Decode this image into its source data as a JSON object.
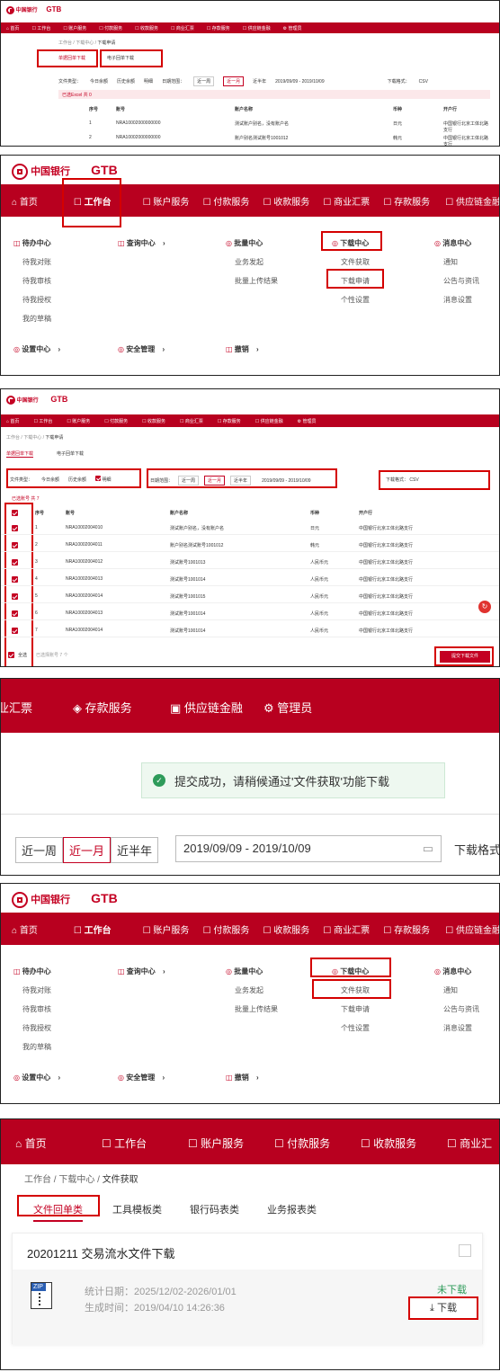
{
  "bank": {
    "name_cn": "中国银行",
    "name_en": "BANK OF CHINA",
    "product": "GTB"
  },
  "nav": {
    "home": "首页",
    "workbench": "工作台",
    "account": "账户服务",
    "payment": "付款服务",
    "collection": "收款服务",
    "bill": "商业汇票",
    "deposit": "存款服务",
    "supply": "供应链金融",
    "admin": "管理员",
    "p1_collection": "收款服务",
    "p1_bill": "商业汇票",
    "p6_bill": "商业汇"
  },
  "p1": {
    "breadcrumb": [
      "工作台",
      "下载中心",
      "下载申请"
    ],
    "tabs": [
      "单据回单下载",
      "电子回单下载"
    ],
    "filters": {
      "label": "文件类型：",
      "today": "今日余额",
      "history": "历史余额",
      "detail": "明细",
      "range_label": "日期范围：",
      "week": "近一周",
      "month": "近一月",
      "half": "近半年",
      "date": "2019/09/09 - 2019/10/09",
      "fmt_label": "下载格式：",
      "fmt": "CSV"
    },
    "selected": "已选Excel  共 0",
    "headers": [
      "序号",
      "账号",
      "账户名称",
      "币种",
      "开户行"
    ],
    "rows": [
      {
        "no": "1",
        "acct": "NRA10002000000000",
        "name": "测试账户别名，没有账户名",
        "cur": "日元",
        "bank": "中国银行北京工体北路支行"
      },
      {
        "no": "2",
        "acct": "NRA10002000000000",
        "name": "账户别名测试账号1001012",
        "cur": "韩元",
        "bank": "中国银行北京工体北路支行"
      }
    ]
  },
  "menu": {
    "pending": "待办中心",
    "pending_items": [
      "待我对账",
      "待我审核",
      "待我授权",
      "我的草稿"
    ],
    "query": "查询中心",
    "batch": "批量中心",
    "batch_items": [
      "业务发起",
      "批量上传结果"
    ],
    "download": "下载中心",
    "download_items": [
      "文件获取",
      "下载申请",
      "个性设置"
    ],
    "message": "消息中心",
    "message_items": [
      "通知",
      "公告与资讯",
      "消息设置"
    ],
    "settings": "设置中心",
    "security": "安全管理",
    "revoke": "撤销",
    "arrow": "›"
  },
  "p3": {
    "breadcrumb": [
      "工作台",
      "下载中心",
      "下载申请"
    ],
    "tabs": [
      "单据回单下载",
      "电子回单下载"
    ],
    "filters": {
      "label": "文件类型：",
      "today": "今日余额",
      "history": "历史余额",
      "detail": "明细",
      "range_label": "日期范围：",
      "week": "近一周",
      "month": "近一月",
      "half": "近半年",
      "date": "2019/09/09 - 2019/10/09",
      "fmt_label": "下载格式：",
      "fmt": "CSV"
    },
    "selected": "已选账号  共 7",
    "headers": [
      "序号",
      "账号",
      "账户名称",
      "币种",
      "开户行"
    ],
    "rows": [
      {
        "no": "1",
        "acct": "NRA10002004010",
        "name": "测试账户别名，没有账户名",
        "cur": "日元",
        "bank": "中国银行北京工体北路支行"
      },
      {
        "no": "2",
        "acct": "NRA10002004011",
        "name": "账户别名测试账号1001012",
        "cur": "韩元",
        "bank": "中国银行北京工体北路支行"
      },
      {
        "no": "3",
        "acct": "NRA10002004012",
        "name": "测试账号1001013",
        "cur": "人民币元",
        "bank": "中国银行北京工体北路支行"
      },
      {
        "no": "4",
        "acct": "NRA10002004013",
        "name": "测试账号1001014",
        "cur": "人民币元",
        "bank": "中国银行北京工体北路支行"
      },
      {
        "no": "5",
        "acct": "NRA10002004014",
        "name": "测试账号1001015",
        "cur": "人民币元",
        "bank": "中国银行北京工体北路支行"
      },
      {
        "no": "6",
        "acct": "NRA10002004013",
        "name": "测试账号1001014",
        "cur": "人民币元",
        "bank": "中国银行北京工体北路支行"
      },
      {
        "no": "7",
        "acct": "NRA10002004014",
        "name": "测试账号1001014",
        "cur": "人民币元",
        "bank": "中国银行北京工体北路支行"
      }
    ],
    "select_all": "全选",
    "footer_note": "已选择账号 7 个",
    "submit": "提交下载文件"
  },
  "p4": {
    "nav": {
      "bill": "业汇票",
      "deposit": "存款服务",
      "supply": "供应链金融",
      "admin": "管理员"
    },
    "toast": "提交成功，请稍候通过'文件获取'功能下载",
    "week": "近一周",
    "month": "近一月",
    "half": "近半年",
    "date": "2019/09/09 - 2019/10/09",
    "fmt": "下载格式"
  },
  "p6": {
    "breadcrumb": [
      "工作台",
      "下载中心",
      "文件获取"
    ],
    "tabs": [
      "文件回单类",
      "工具模板类",
      "银行码表类",
      "业务报表类"
    ],
    "card_title": "20201211 交易流水文件下载",
    "stat_date": "统计日期：2025/12/02-2026/01/01",
    "gen_time": "生成时间：2019/04/10 14:26:36",
    "status": "未下载",
    "download": "下载",
    "zip": "ZIP",
    "colors": {
      "brand": "#b8001f",
      "highlight": "#d40000",
      "success_green": "#2e9b5a"
    }
  }
}
